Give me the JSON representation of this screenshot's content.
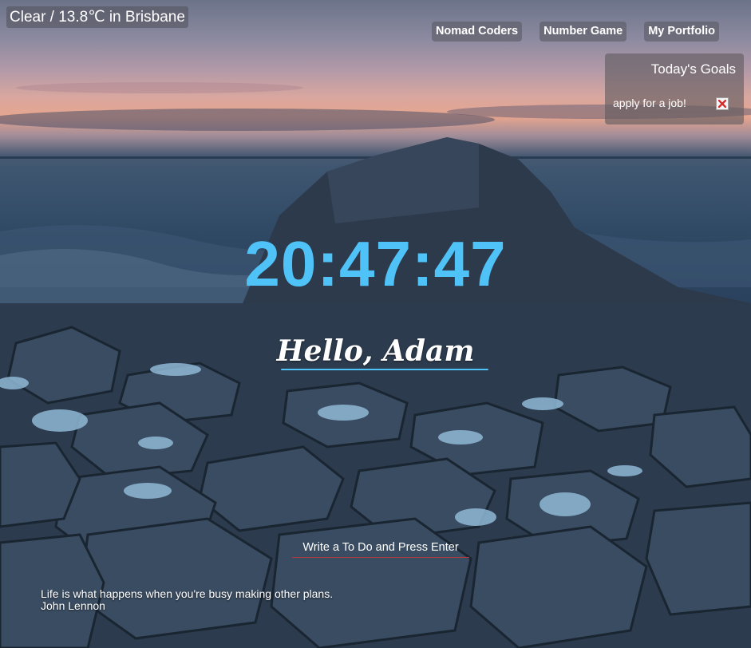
{
  "weather": {
    "text": "Clear / 13.8℃ in Brisbane"
  },
  "nav": {
    "links": [
      {
        "label": "Nomad Coders"
      },
      {
        "label": "Number Game"
      },
      {
        "label": "My Portfolio"
      }
    ]
  },
  "goals": {
    "title": "Today's Goals",
    "items": [
      {
        "label": "apply for a job!"
      }
    ]
  },
  "clock": {
    "time": "20:47:47",
    "color": "#4fc3f7"
  },
  "greeting": {
    "text": "Hello, Adam"
  },
  "todo": {
    "placeholder": "Write a To Do and Press Enter"
  },
  "quote": {
    "text": "Life is what happens when you're busy making other plans.",
    "author": "John Lennon"
  }
}
